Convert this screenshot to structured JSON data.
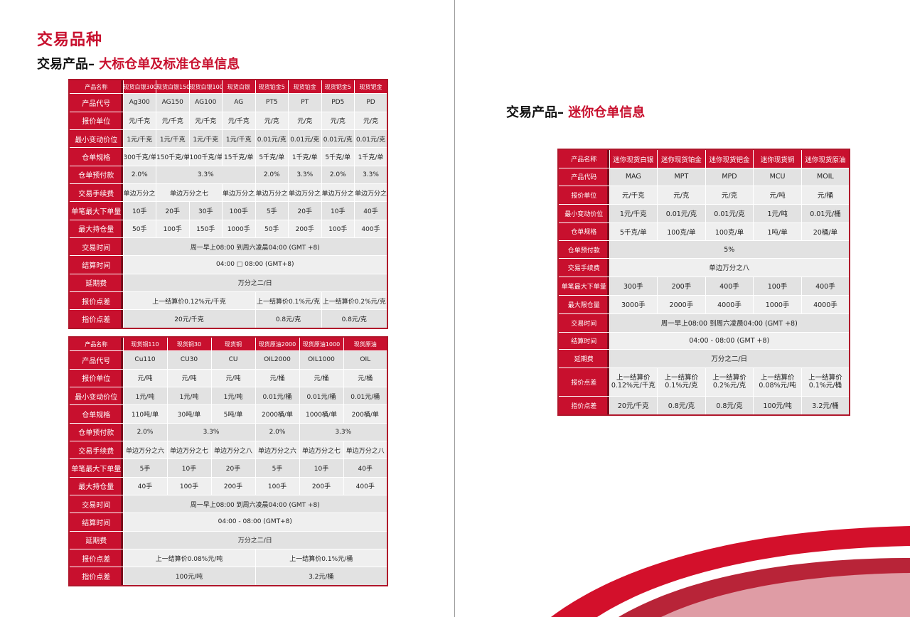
{
  "left_page": {
    "title": "交易品种",
    "subtitle_prefix": "交易产品– ",
    "subtitle_highlight": "大标仓单及标准仓单信息"
  },
  "right_page": {
    "subtitle_prefix": "交易产品– ",
    "subtitle_highlight": "迷你仓单信息"
  },
  "table_silver_platinum": {
    "rows": [
      {
        "label": "产品名称",
        "cells": [
          {
            "t": "现货白银300"
          },
          {
            "t": "现货白银150"
          },
          {
            "t": "现货白银100"
          },
          {
            "t": "现货白银"
          },
          {
            "t": "现货铂金5"
          },
          {
            "t": "现货铂金"
          },
          {
            "t": "现货钯金5"
          },
          {
            "t": "现货钯金"
          }
        ]
      },
      {
        "label": "产品代号",
        "cells": [
          {
            "t": "Ag300"
          },
          {
            "t": "AG150"
          },
          {
            "t": "AG100"
          },
          {
            "t": "AG"
          },
          {
            "t": "PT5"
          },
          {
            "t": "PT"
          },
          {
            "t": "PD5"
          },
          {
            "t": "PD"
          }
        ]
      },
      {
        "label": "报价单位",
        "cells": [
          {
            "t": "元/千克"
          },
          {
            "t": "元/千克"
          },
          {
            "t": "元/千克"
          },
          {
            "t": "元/千克"
          },
          {
            "t": "元/克"
          },
          {
            "t": "元/克"
          },
          {
            "t": "元/克"
          },
          {
            "t": "元/克"
          }
        ]
      },
      {
        "label": "最小变动价位",
        "cells": [
          {
            "t": "1元/千克"
          },
          {
            "t": "1元/千克"
          },
          {
            "t": "1元/千克"
          },
          {
            "t": "1元/千克"
          },
          {
            "t": "0.01元/克"
          },
          {
            "t": "0.01元/克"
          },
          {
            "t": "0.01元/克"
          },
          {
            "t": "0.01元/克"
          }
        ]
      },
      {
        "label": "仓单规格",
        "cells": [
          {
            "t": "300千克/单"
          },
          {
            "t": "150千克/单"
          },
          {
            "t": "100千克/单"
          },
          {
            "t": "15千克/单"
          },
          {
            "t": "5千克/单"
          },
          {
            "t": "1千克/单"
          },
          {
            "t": "5千克/单"
          },
          {
            "t": "1千克/单"
          }
        ]
      },
      {
        "label": "仓单预付款",
        "cells": [
          {
            "t": "2.0%"
          },
          {
            "t": "3.3%",
            "span": 3
          },
          {
            "t": "2.0%"
          },
          {
            "t": "3.3%"
          },
          {
            "t": "2.0%"
          },
          {
            "t": "3.3%"
          }
        ]
      },
      {
        "label": "交易手续费",
        "cells": [
          {
            "t": "单边万分之六"
          },
          {
            "t": "单边万分之七",
            "span": 2
          },
          {
            "t": "单边万分之八"
          },
          {
            "t": "单边万分之六"
          },
          {
            "t": "单边万分之八"
          },
          {
            "t": "单边万分之六"
          },
          {
            "t": "单边万分之八"
          }
        ]
      },
      {
        "label": "单笔最大下单量",
        "cells": [
          {
            "t": "10手"
          },
          {
            "t": "20手"
          },
          {
            "t": "30手"
          },
          {
            "t": "100手"
          },
          {
            "t": "5手"
          },
          {
            "t": "20手"
          },
          {
            "t": "10手"
          },
          {
            "t": "40手"
          }
        ]
      },
      {
        "label": "最大持仓量",
        "cells": [
          {
            "t": "50手"
          },
          {
            "t": "100手"
          },
          {
            "t": "150手"
          },
          {
            "t": "1000手"
          },
          {
            "t": "50手"
          },
          {
            "t": "200手"
          },
          {
            "t": "100手"
          },
          {
            "t": "400手"
          }
        ]
      },
      {
        "label": "交易时间",
        "cells": [
          {
            "t": "周一早上08:00 到周六凌晨04:00 (GMT +8)",
            "span": 8
          }
        ]
      },
      {
        "label": "结算时间",
        "cells": [
          {
            "t": "04:00 □ 08:00 (GMT+8)",
            "span": 8
          }
        ]
      },
      {
        "label": "延期费",
        "cells": [
          {
            "t": "万分之二/日",
            "span": 8
          }
        ]
      },
      {
        "label": "报价点差",
        "cells": [
          {
            "t": "上一结算价0.12%元/千克",
            "span": 4
          },
          {
            "t": "上一结算价0.1%元/克",
            "span": 2
          },
          {
            "t": "上一结算价0.2%元/克",
            "span": 2
          }
        ]
      },
      {
        "label": "指价点差",
        "cells": [
          {
            "t": "20元/千克",
            "span": 4
          },
          {
            "t": "0.8元/克",
            "span": 2
          },
          {
            "t": "0.8元/克",
            "span": 2
          }
        ]
      }
    ]
  },
  "table_copper_oil": {
    "rows": [
      {
        "label": "产品名称",
        "cells": [
          {
            "t": "现货铜110"
          },
          {
            "t": "现货铜30"
          },
          {
            "t": "现货铜"
          },
          {
            "t": "现货原油2000"
          },
          {
            "t": "现货原油1000"
          },
          {
            "t": "现货原油"
          }
        ]
      },
      {
        "label": "产品代号",
        "cells": [
          {
            "t": "Cu110"
          },
          {
            "t": "CU30"
          },
          {
            "t": "CU"
          },
          {
            "t": "OIL2000"
          },
          {
            "t": "OIL1000"
          },
          {
            "t": "OIL"
          }
        ]
      },
      {
        "label": "报价单位",
        "cells": [
          {
            "t": "元/吨"
          },
          {
            "t": "元/吨"
          },
          {
            "t": "元/吨"
          },
          {
            "t": "元/桶"
          },
          {
            "t": "元/桶"
          },
          {
            "t": "元/桶"
          }
        ]
      },
      {
        "label": "最小变动价位",
        "cells": [
          {
            "t": "1元/吨"
          },
          {
            "t": "1元/吨"
          },
          {
            "t": "1元/吨"
          },
          {
            "t": "0.01元/桶"
          },
          {
            "t": "0.01元/桶"
          },
          {
            "t": "0.01元/桶"
          }
        ]
      },
      {
        "label": "仓单规格",
        "cells": [
          {
            "t": "110吨/单"
          },
          {
            "t": "30吨/单"
          },
          {
            "t": "5吨/单"
          },
          {
            "t": "2000桶/单"
          },
          {
            "t": "1000桶/单"
          },
          {
            "t": "200桶/单"
          }
        ]
      },
      {
        "label": "仓单预付款",
        "cells": [
          {
            "t": "2.0%"
          },
          {
            "t": "3.3%",
            "span": 2
          },
          {
            "t": "2.0%"
          },
          {
            "t": "3.3%",
            "span": 2
          }
        ]
      },
      {
        "label": "交易手续费",
        "cells": [
          {
            "t": "单边万分之六"
          },
          {
            "t": "单边万分之七"
          },
          {
            "t": "单边万分之八"
          },
          {
            "t": "单边万分之六"
          },
          {
            "t": "单边万分之七"
          },
          {
            "t": "单边万分之八"
          }
        ]
      },
      {
        "label": "单笔最大下单量",
        "cells": [
          {
            "t": "5手"
          },
          {
            "t": "10手"
          },
          {
            "t": "20手"
          },
          {
            "t": "5手"
          },
          {
            "t": "10手"
          },
          {
            "t": "40手"
          }
        ]
      },
      {
        "label": "最大持仓量",
        "cells": [
          {
            "t": "40手"
          },
          {
            "t": "100手"
          },
          {
            "t": "200手"
          },
          {
            "t": "100手"
          },
          {
            "t": "200手"
          },
          {
            "t": "400手"
          }
        ]
      },
      {
        "label": "交易时间",
        "cells": [
          {
            "t": "周一早上08:00 到周六凌晨04:00 (GMT +8)",
            "span": 6
          }
        ]
      },
      {
        "label": "结算时间",
        "cells": [
          {
            "t": "04:00 - 08:00 (GMT+8)",
            "span": 6
          }
        ]
      },
      {
        "label": "延期费",
        "cells": [
          {
            "t": "万分之二/日",
            "span": 6
          }
        ]
      },
      {
        "label": "报价点差",
        "cells": [
          {
            "t": "上一结算价0.08%元/吨",
            "span": 3
          },
          {
            "t": "上一结算价0.1%元/桶",
            "span": 3
          }
        ]
      },
      {
        "label": "指价点差",
        "cells": [
          {
            "t": "100元/吨",
            "span": 3
          },
          {
            "t": "3.2元/桶",
            "span": 3
          }
        ]
      }
    ]
  },
  "table_mini": {
    "rows": [
      {
        "label": "产品名称",
        "cells": [
          {
            "t": "迷你现货白银"
          },
          {
            "t": "迷你现货铂金"
          },
          {
            "t": "迷你现货钯金"
          },
          {
            "t": "迷你现货铜"
          },
          {
            "t": "迷你现货原油"
          }
        ]
      },
      {
        "label": "产品代码",
        "cells": [
          {
            "t": "MAG"
          },
          {
            "t": "MPT"
          },
          {
            "t": "MPD"
          },
          {
            "t": "MCU"
          },
          {
            "t": "MOIL"
          }
        ]
      },
      {
        "label": "报价单位",
        "cells": [
          {
            "t": "元/千克"
          },
          {
            "t": "元/克"
          },
          {
            "t": "元/克"
          },
          {
            "t": "元/吨"
          },
          {
            "t": "元/桶"
          }
        ]
      },
      {
        "label": "最小变动价位",
        "cells": [
          {
            "t": "1元/千克"
          },
          {
            "t": "0.01元/克"
          },
          {
            "t": "0.01元/克"
          },
          {
            "t": "1元/吨"
          },
          {
            "t": "0.01元/桶"
          }
        ]
      },
      {
        "label": "仓单规格",
        "cells": [
          {
            "t": "5千克/单"
          },
          {
            "t": "100克/单"
          },
          {
            "t": "100克/单"
          },
          {
            "t": "1吨/单"
          },
          {
            "t": "20桶/单"
          }
        ]
      },
      {
        "label": "仓单预付款",
        "cells": [
          {
            "t": "5%",
            "span": 5
          }
        ]
      },
      {
        "label": "交易手续费",
        "cells": [
          {
            "t": "单边万分之八",
            "span": 5
          }
        ]
      },
      {
        "label": "单笔最大下单量",
        "cells": [
          {
            "t": "300手"
          },
          {
            "t": "200手"
          },
          {
            "t": "400手"
          },
          {
            "t": "100手"
          },
          {
            "t": "400手"
          }
        ]
      },
      {
        "label": "最大限仓量",
        "cells": [
          {
            "t": "3000手"
          },
          {
            "t": "2000手"
          },
          {
            "t": "4000手"
          },
          {
            "t": "1000手"
          },
          {
            "t": "4000手"
          }
        ]
      },
      {
        "label": "交易时间",
        "cells": [
          {
            "t": "周一早上08:00 到周六凌晨04:00 (GMT +8)",
            "span": 5
          }
        ]
      },
      {
        "label": "结算时间",
        "cells": [
          {
            "t": "04:00 - 08:00 (GMT +8)",
            "span": 5
          }
        ]
      },
      {
        "label": "延期费",
        "cells": [
          {
            "t": "万分之二/日",
            "span": 5
          }
        ]
      },
      {
        "label": "报价点差",
        "cells": [
          {
            "t": "上一结算价 0.12%元/千克"
          },
          {
            "t": "上一结算价 0.1%元/克"
          },
          {
            "t": "上一结算价 0.2%元/克"
          },
          {
            "t": "上一结算价 0.08%元/吨"
          },
          {
            "t": "上一结算价 0.1%元/桶"
          }
        ]
      },
      {
        "label": "指价点差",
        "cells": [
          {
            "t": "20元/千克"
          },
          {
            "t": "0.8元/克"
          },
          {
            "t": "0.8元/克"
          },
          {
            "t": "100元/吨"
          },
          {
            "t": "3.2元/桶"
          }
        ]
      }
    ]
  }
}
